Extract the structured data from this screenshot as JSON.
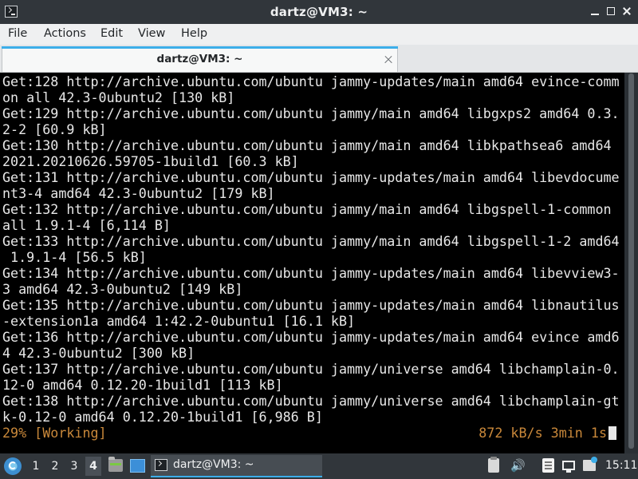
{
  "window": {
    "title": "dartz@VM3: ~"
  },
  "menubar": {
    "items": [
      "File",
      "Actions",
      "Edit",
      "View",
      "Help"
    ]
  },
  "tabs": [
    {
      "label": "dartz@VM3: ~",
      "active": true
    }
  ],
  "terminal": {
    "lines": [
      "Get:128 http://archive.ubuntu.com/ubuntu jammy-updates/main amd64 evince-comm",
      "on all 42.3-0ubuntu2 [130 kB]",
      "Get:129 http://archive.ubuntu.com/ubuntu jammy/main amd64 libgxps2 amd64 0.3.",
      "2-2 [60.9 kB]",
      "Get:130 http://archive.ubuntu.com/ubuntu jammy/main amd64 libkpathsea6 amd64",
      "2021.20210626.59705-1build1 [60.3 kB]",
      "Get:131 http://archive.ubuntu.com/ubuntu jammy-updates/main amd64 libevdocume",
      "nt3-4 amd64 42.3-0ubuntu2 [179 kB]",
      "Get:132 http://archive.ubuntu.com/ubuntu jammy/main amd64 libgspell-1-common",
      "all 1.9.1-4 [6,114 B]",
      "Get:133 http://archive.ubuntu.com/ubuntu jammy/main amd64 libgspell-1-2 amd64",
      " 1.9.1-4 [56.5 kB]",
      "Get:134 http://archive.ubuntu.com/ubuntu jammy-updates/main amd64 libevview3-",
      "3 amd64 42.3-0ubuntu2 [149 kB]",
      "Get:135 http://archive.ubuntu.com/ubuntu jammy-updates/main amd64 libnautilus",
      "-extension1a amd64 1:42.2-0ubuntu1 [16.1 kB]",
      "Get:136 http://archive.ubuntu.com/ubuntu jammy-updates/main amd64 evince amd6",
      "4 42.3-0ubuntu2 [300 kB]",
      "Get:137 http://archive.ubuntu.com/ubuntu jammy/universe amd64 libchamplain-0.",
      "12-0 amd64 0.12.20-1build1 [113 kB]",
      "Get:138 http://archive.ubuntu.com/ubuntu jammy/universe amd64 libchamplain-gt",
      "k-0.12-0 amd64 0.12.20-1build1 [6,986 B]"
    ],
    "status_left": "29% [Working]",
    "status_right": "872 kB/s 3min 1s",
    "status_color": "#c9883a"
  },
  "taskbar": {
    "desktops": [
      "1",
      "2",
      "3",
      "4"
    ],
    "active_desktop": "4",
    "task_label": "dartz@VM3: ~",
    "clock": "15:11",
    "volume_glyph": "🔊",
    "accent": "#3daee9"
  }
}
